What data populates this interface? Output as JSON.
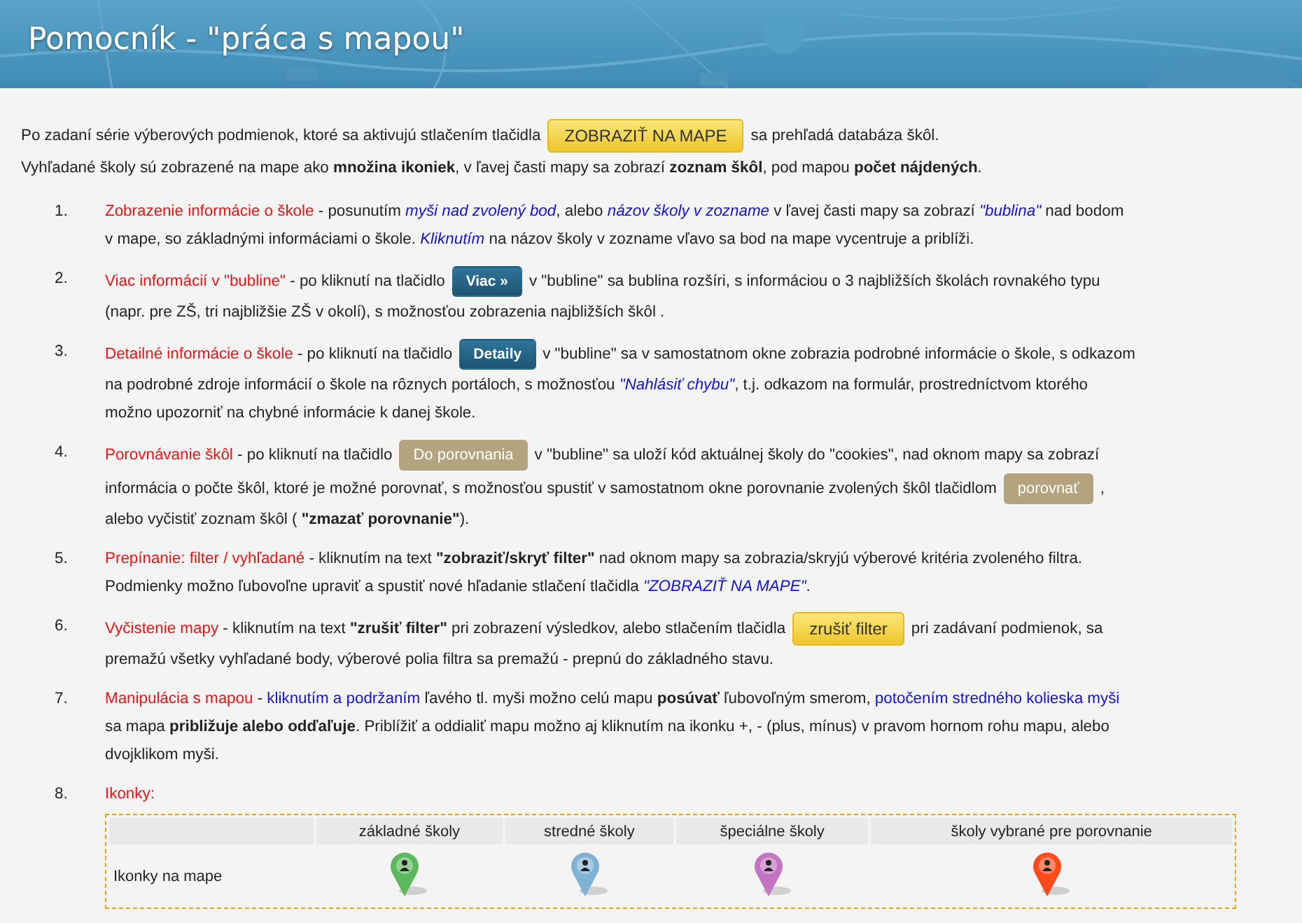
{
  "header": {
    "title": "Pomocník - \"práca s mapou\""
  },
  "intro": [
    {
      "parts": [
        {
          "kind": "text",
          "runs": [
            {
              "kind": "plain",
              "text": "Po zadaní série výberových podmienok, ktoré sa aktivujú stlačením tlačidla"
            }
          ]
        },
        {
          "kind": "action",
          "text": "ZOBRAZIŤ NA MAPE"
        },
        {
          "kind": "text",
          "runs": [
            {
              "kind": "plain",
              "text": "sa prehľadá databáza škôl."
            }
          ]
        }
      ]
    },
    {
      "parts": [
        {
          "kind": "text",
          "runs": [
            {
              "kind": "plain",
              "text": "Vyhľadané školy sú zobrazené na mape ako **množina ikoniek**, v ľavej časti mapy sa zobrazí **zoznam škôl**, pod mapou **počet nájdených**."
            }
          ]
        }
      ]
    }
  ],
  "items": [
    {
      "number": "1.",
      "lines": [
        {
          "parts": [
            {
              "kind": "text",
              "runs": [
                {
                  "kind": "title",
                  "text": "Zobrazenie informácie o škole"
                },
                {
                  "kind": "plain",
                  "text": "- posunutím"
                },
                {
                  "kind": "em",
                  "text": "myši nad zvolený bod"
                },
                {
                  "kind": "plain",
                  "text": ", alebo"
                },
                {
                  "kind": "em",
                  "text": "názov školy v zozname"
                },
                {
                  "kind": "plain",
                  "text": "v ľavej časti mapy sa zobrazí"
                },
                {
                  "kind": "em",
                  "text": "\"bublina\""
                },
                {
                  "kind": "plain",
                  "text": "nad bodom"
                }
              ]
            }
          ]
        },
        {
          "parts": [
            {
              "kind": "text",
              "runs": [
                {
                  "kind": "plain",
                  "text": "v mape, so základnými informáciami o škole."
                },
                {
                  "kind": "em",
                  "text": "Kliknutím"
                },
                {
                  "kind": "plain",
                  "text": "na názov školy v zozname vľavo sa bod na mape vycentruje a priblíži."
                }
              ]
            }
          ]
        }
      ]
    },
    {
      "number": "2.",
      "lines": [
        {
          "parts": [
            {
              "kind": "text",
              "runs": [
                {
                  "kind": "title",
                  "text": "Viac informácií v \"bubline\""
                },
                {
                  "kind": "plain",
                  "text": "- po kliknutí na tlačidlo"
                }
              ]
            },
            {
              "kind": "detail",
              "text": "Viac »"
            },
            {
              "kind": "text",
              "runs": [
                {
                  "kind": "plain",
                  "text": "v \"bubline\" sa bublina rozšíri, s informáciou o 3 najbližších školách rovnakého typu"
                }
              ]
            }
          ]
        },
        {
          "parts": [
            {
              "kind": "text",
              "runs": [
                {
                  "kind": "plain",
                  "text": "(napr. pre ZŠ, tri najbližšie ZŠ v okolí), s možnosťou zobrazenia najbližších škôl ."
                }
              ]
            }
          ]
        }
      ]
    },
    {
      "number": "3.",
      "lines": [
        {
          "parts": [
            {
              "kind": "text",
              "runs": [
                {
                  "kind": "title",
                  "text": "Detailné informácie o škole"
                },
                {
                  "kind": "plain",
                  "text": "- po kliknutí na tlačidlo"
                }
              ]
            },
            {
              "kind": "detail",
              "text": "Detaily"
            },
            {
              "kind": "text",
              "runs": [
                {
                  "kind": "plain",
                  "text": "v \"bubline\" sa v samostatnom okne zobrazia podrobné informácie o škole, s odkazom"
                }
              ]
            }
          ]
        },
        {
          "parts": [
            {
              "kind": "text",
              "runs": [
                {
                  "kind": "plain",
                  "text": "na podrobné zdroje informácií o škole na rôznych portáloch, s možnosťou"
                },
                {
                  "kind": "em",
                  "text": "\"Nahlásiť chybu\""
                },
                {
                  "kind": "plain",
                  "text": ", t.j. odkazom na formulár, prostredníctvom ktorého"
                }
              ]
            }
          ]
        },
        {
          "parts": [
            {
              "kind": "text",
              "runs": [
                {
                  "kind": "plain",
                  "text": "možno upozorniť na chybné informácie k danej škole."
                }
              ]
            }
          ]
        }
      ]
    },
    {
      "number": "4.",
      "lines": [
        {
          "parts": [
            {
              "kind": "text",
              "runs": [
                {
                  "kind": "title",
                  "text": "Porovnávanie škôl"
                },
                {
                  "kind": "plain",
                  "text": "- po kliknutí na tlačidlo"
                }
              ]
            },
            {
              "kind": "compare",
              "text": "Do porovnania"
            },
            {
              "kind": "text",
              "runs": [
                {
                  "kind": "plain",
                  "text": "v \"bubline\" sa uloží kód aktuálnej školy do \"cookies\", nad oknom mapy sa zobrazí"
                }
              ]
            }
          ]
        },
        {
          "parts": [
            {
              "kind": "text",
              "runs": [
                {
                  "kind": "plain",
                  "text": "informácia o počte škôl, ktoré je možné porovnať, s možnosťou spustiť v samostatnom okne porovnanie zvolených škôl tlačidlom"
                }
              ]
            },
            {
              "kind": "compare",
              "text": "porovnať"
            },
            {
              "kind": "text",
              "runs": [
                {
                  "kind": "plain",
                  "text": ","
                }
              ]
            }
          ]
        },
        {
          "parts": [
            {
              "kind": "text",
              "runs": [
                {
                  "kind": "plain",
                  "text": "alebo vyčistiť zoznam škôl ( **\"zmazať porovnanie\"**)."
                }
              ]
            }
          ]
        }
      ]
    },
    {
      "number": "5.",
      "lines": [
        {
          "parts": [
            {
              "kind": "text",
              "runs": [
                {
                  "kind": "title",
                  "text": "Prepínanie: filter / vyhľadané"
                },
                {
                  "kind": "plain",
                  "text": "- kliknutím na text **\"zobraziť/skryť filter\"** nad oknom mapy sa zobrazia/skryjú výberové kritéria zvoleného filtra."
                }
              ]
            }
          ]
        },
        {
          "parts": [
            {
              "kind": "text",
              "runs": [
                {
                  "kind": "plain",
                  "text": "Podmienky možno ľubovoľne upraviť a spustiť nové hľadanie stlačení tlačidla"
                },
                {
                  "kind": "em",
                  "text": "\"ZOBRAZIŤ NA MAPE\""
                },
                {
                  "kind": "plain",
                  "text": "."
                }
              ]
            }
          ]
        }
      ]
    },
    {
      "number": "6.",
      "lines": [
        {
          "parts": [
            {
              "kind": "text",
              "runs": [
                {
                  "kind": "title",
                  "text": "Vyčistenie mapy"
                },
                {
                  "kind": "plain",
                  "text": "- kliknutím na text **\"zrušiť filter\"** pri zobrazení výsledkov, alebo stlačením tlačidla"
                }
              ]
            },
            {
              "kind": "action",
              "text": "zrušiť filter"
            },
            {
              "kind": "text",
              "runs": [
                {
                  "kind": "plain",
                  "text": "pri zadávaní podmienok, sa"
                }
              ]
            }
          ]
        },
        {
          "parts": [
            {
              "kind": "text",
              "runs": [
                {
                  "kind": "plain",
                  "text": "premažú všetky vyhľadané body, výberové polia filtra sa premažú - prepnú do základného stavu."
                }
              ]
            }
          ]
        }
      ]
    },
    {
      "number": "7.",
      "lines": [
        {
          "parts": [
            {
              "kind": "text",
              "runs": [
                {
                  "kind": "title",
                  "text": "Manipulácia s mapou"
                },
                {
                  "kind": "plain",
                  "text": "-"
                },
                {
                  "kind": "link",
                  "text": "kliknutím a podržaním"
                },
                {
                  "kind": "plain",
                  "text": "ľavého tl. myši možno celú mapu **posúvať** ľubovoľným smerom,"
                },
                {
                  "kind": "link",
                  "text": "potočením stredného kolieska myši"
                }
              ]
            }
          ]
        },
        {
          "parts": [
            {
              "kind": "text",
              "runs": [
                {
                  "kind": "plain",
                  "text": "sa mapa **približuje alebo odďaľuje**. Priblížiť a oddialiť mapu možno aj kliknutím na ikonku +, - (plus, mínus) v pravom hornom rohu mapu, alebo"
                }
              ]
            }
          ]
        },
        {
          "parts": [
            {
              "kind": "text",
              "runs": [
                {
                  "kind": "plain",
                  "text": "dvojklikom myši."
                }
              ]
            }
          ]
        }
      ]
    },
    {
      "number": "8.",
      "lines": [
        {
          "parts": [
            {
              "kind": "text",
              "runs": [
                {
                  "kind": "title",
                  "text": "Ikonky:"
                }
              ]
            }
          ]
        }
      ],
      "table": {
        "columns": [
          "základné školy",
          "stredné školy",
          "špeciálne školy",
          "školy vybrané pre porovnanie"
        ],
        "rows": [
          {
            "label": "Ikonky na mape",
            "icons": [
              {
                "color": "#5cb85c"
              },
              {
                "color": "#7fb2d4"
              },
              {
                "color": "#c374c3"
              },
              {
                "color": "#ff4a1c"
              }
            ]
          }
        ]
      }
    }
  ]
}
